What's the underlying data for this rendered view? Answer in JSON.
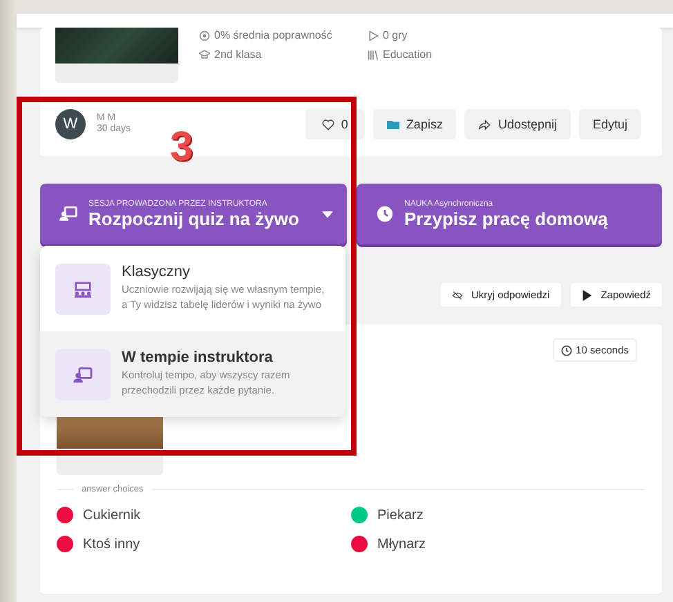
{
  "quiz_info": {
    "stats": [
      {
        "kind": "accuracy",
        "text": "0% średnia poprawność"
      },
      {
        "kind": "plays",
        "text": "0 gry"
      }
    ],
    "meta": [
      {
        "kind": "grade",
        "text": "2nd klasa"
      },
      {
        "kind": "subject",
        "text": "Education"
      }
    ]
  },
  "author": {
    "initial": "W",
    "name": "M M",
    "time": "30 days"
  },
  "actions": [
    {
      "kind": "like",
      "label": "0"
    },
    {
      "kind": "save",
      "label": "Zapisz"
    },
    {
      "kind": "share",
      "label": "Udostępnij"
    },
    {
      "kind": "edit",
      "label": "Edytuj"
    }
  ],
  "annotation": {
    "label": "3"
  },
  "start_buttons": [
    {
      "kind": "live",
      "caption": "SESJA PROWADZONA PRZEZ INSTRUKTORA",
      "label": "Rozpocznij quiz na żywo"
    },
    {
      "kind": "homework",
      "caption": "NAUKA Asynchroniczna",
      "label": "Przypisz pracę domową"
    }
  ],
  "live_menu": {
    "expanded": true,
    "items": [
      {
        "kind": "classic",
        "title": "Klasyczny",
        "description": "Uczniowie rozwijają się we własnym tempie, a Ty widzisz tabelę liderów i wyniki na żywo",
        "selected": false
      },
      {
        "kind": "paced",
        "title": "W tempie instruktora",
        "description": "Kontroluj tempo, aby wszyscy razem przechodzili przez każde pytanie.",
        "selected": true
      }
    ]
  },
  "toolbar": [
    {
      "kind": "hide",
      "label": "Ukryj odpowiedzi"
    },
    {
      "kind": "preview",
      "label": "Zapowiedź"
    }
  ],
  "question": {
    "timer": "10 seconds",
    "choices_label": "answer choices",
    "choices": [
      {
        "text": "Cukiernik",
        "color": "#ec0b43"
      },
      {
        "text": "Piekarz",
        "color": "#00c985"
      },
      {
        "text": "Ktoś inny",
        "color": "#ec0b43"
      },
      {
        "text": "Młynarz",
        "color": "#ec0b43"
      }
    ]
  }
}
